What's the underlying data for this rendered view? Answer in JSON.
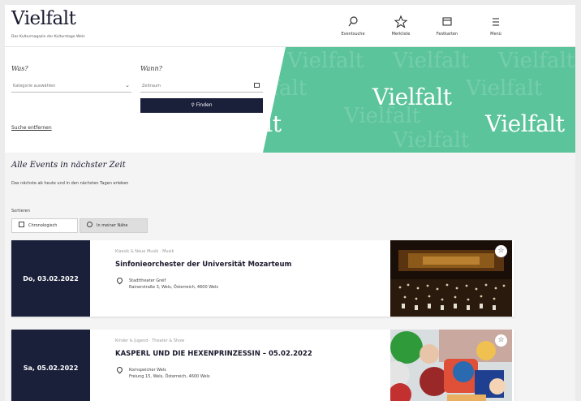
{
  "header": {
    "logo": "Vielfalt",
    "tagline": "Das Kulturmagazin der Kulturstage Wels",
    "nav": [
      {
        "label": "Eventsuche",
        "icon": "search-icon"
      },
      {
        "label": "Merkliste",
        "icon": "star-icon"
      },
      {
        "label": "Festkarten",
        "icon": "ticket-icon"
      },
      {
        "label": "Menü",
        "icon": "menu-icon"
      }
    ]
  },
  "search": {
    "what_label": "Was?",
    "category_placeholder": "Kategorie auswählen",
    "when_label": "Wann?",
    "date_placeholder": "Zeitraum",
    "find_button": "Finden",
    "reset_link": "Suche entfernen"
  },
  "hero": {
    "word": "Vielfalt",
    "background_color": "#5bc49b"
  },
  "events_section": {
    "title": "Alle Events in nächster Zeit",
    "subtitle": "Das nächste ab heute und in den nächsten Tagen erleben",
    "sort_label": "Sortieren",
    "sort_options": [
      {
        "label": "Chronologisch",
        "icon": "calendar-icon",
        "active": false
      },
      {
        "label": "In meiner Nähe",
        "icon": "location-icon",
        "active": true
      }
    ]
  },
  "events": [
    {
      "date": "Do, 03.02.2022",
      "category": "Klassik & Neue Musik · Musik",
      "title": "Sinfonieorchester der Universität Mozarteum",
      "venue_name": "Stadttheater Greif",
      "venue_address": "Rainerstraße 3, Wels, Österreich, 4600 Wels",
      "image": "orchestra-on-stage-photo"
    },
    {
      "date": "Sa, 05.02.2022",
      "category": "Kinder & Jugend · Theater & Show",
      "title": "KASPERL UND DIE HEXENPRINZESSIN – 05.02.2022",
      "venue_name": "Kornspeicher Wels",
      "venue_address": "Freiung 15, Wels, Österreich, 4600 Wels",
      "image": "puppet-theater-photo"
    }
  ],
  "colors": {
    "navy": "#1a1f3a",
    "mint": "#5bc49b",
    "background": "#f4f4f4"
  }
}
